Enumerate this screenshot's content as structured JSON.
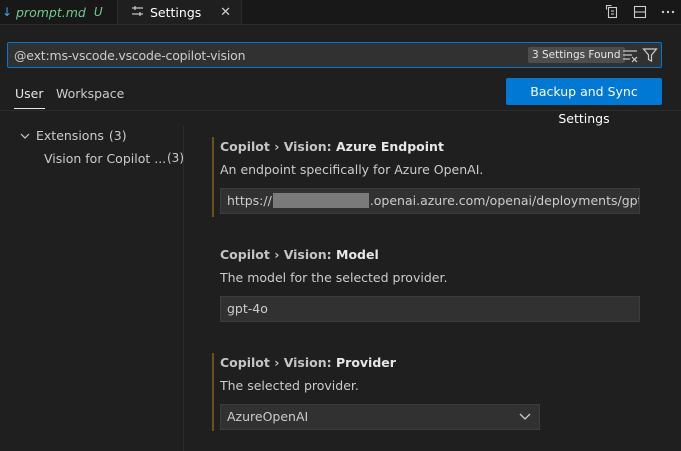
{
  "tabs": [
    {
      "label": "prompt.md",
      "badge": "U"
    },
    {
      "label": "Settings"
    }
  ],
  "search": {
    "value": "@ext:ms-vscode.vscode-copilot-vision",
    "results_badge": "3 Settings Found"
  },
  "scope_tabs": {
    "user": "User",
    "workspace": "Workspace"
  },
  "sync_button": "Backup and Sync Settings",
  "toc": {
    "extensions_label": "Extensions",
    "extensions_count": "(3)",
    "child_label": "Vision for Copilot ...",
    "child_count": "(3)"
  },
  "settings": [
    {
      "category": "Copilot › Vision: ",
      "key": "Azure Endpoint",
      "description": "An endpoint specifically for Azure OpenAI.",
      "value_prefix": "https://",
      "value_suffix": ".openai.azure.com/openai/deployments/gpt-..."
    },
    {
      "category": "Copilot › Vision: ",
      "key": "Model",
      "description": "The model for the selected provider.",
      "value": "gpt-4o"
    },
    {
      "category": "Copilot › Vision: ",
      "key": "Provider",
      "description": "The selected provider.",
      "value": "AzureOpenAI"
    }
  ]
}
